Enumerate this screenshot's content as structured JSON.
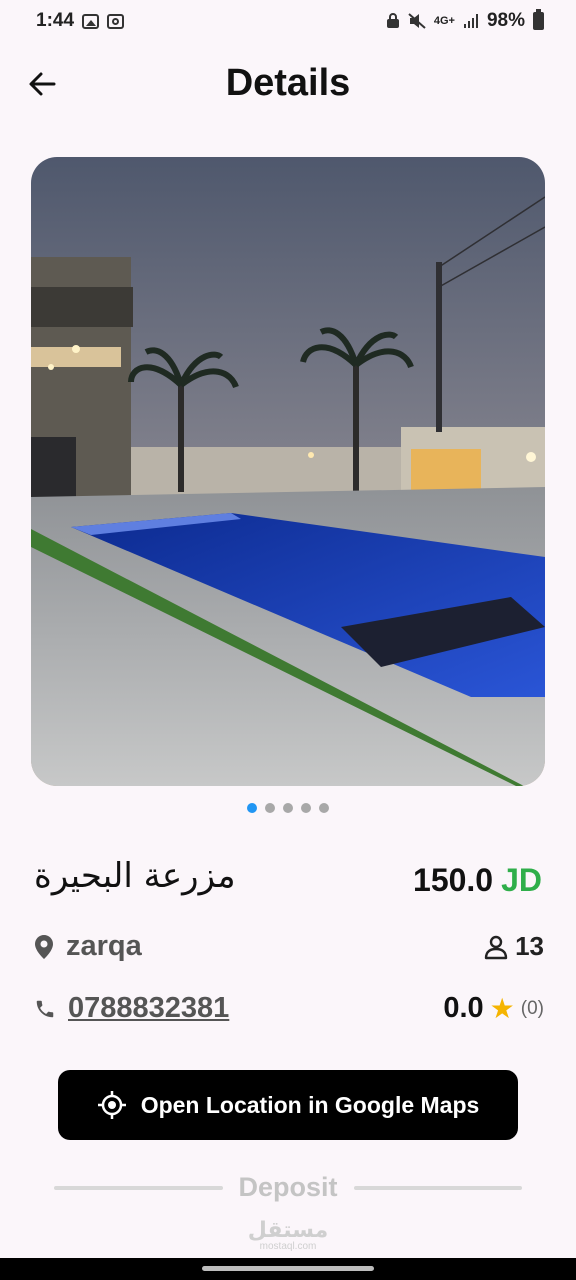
{
  "status_bar": {
    "time": "1:44",
    "network": "4G+",
    "battery": "98%"
  },
  "app_bar": {
    "title": "Details",
    "back_icon": "arrow-left-icon"
  },
  "gallery": {
    "image_count": 5,
    "active_index": 0
  },
  "property": {
    "name": "مزرعة البحيرة",
    "price": "150.0",
    "currency": "JD",
    "location": "zarqa",
    "capacity": "13",
    "phone": "0788832381",
    "rating": "0.0",
    "rating_count": "(0)"
  },
  "actions": {
    "maps_label": "Open Location in Google Maps"
  },
  "section": {
    "deposit_label": "Deposit"
  },
  "watermark": {
    "main": "مستقل",
    "sub": "mostaql.com"
  },
  "colors": {
    "accent": "#2196f3",
    "currency": "#2fae4a",
    "star": "#f5b400",
    "button": "#000000"
  }
}
